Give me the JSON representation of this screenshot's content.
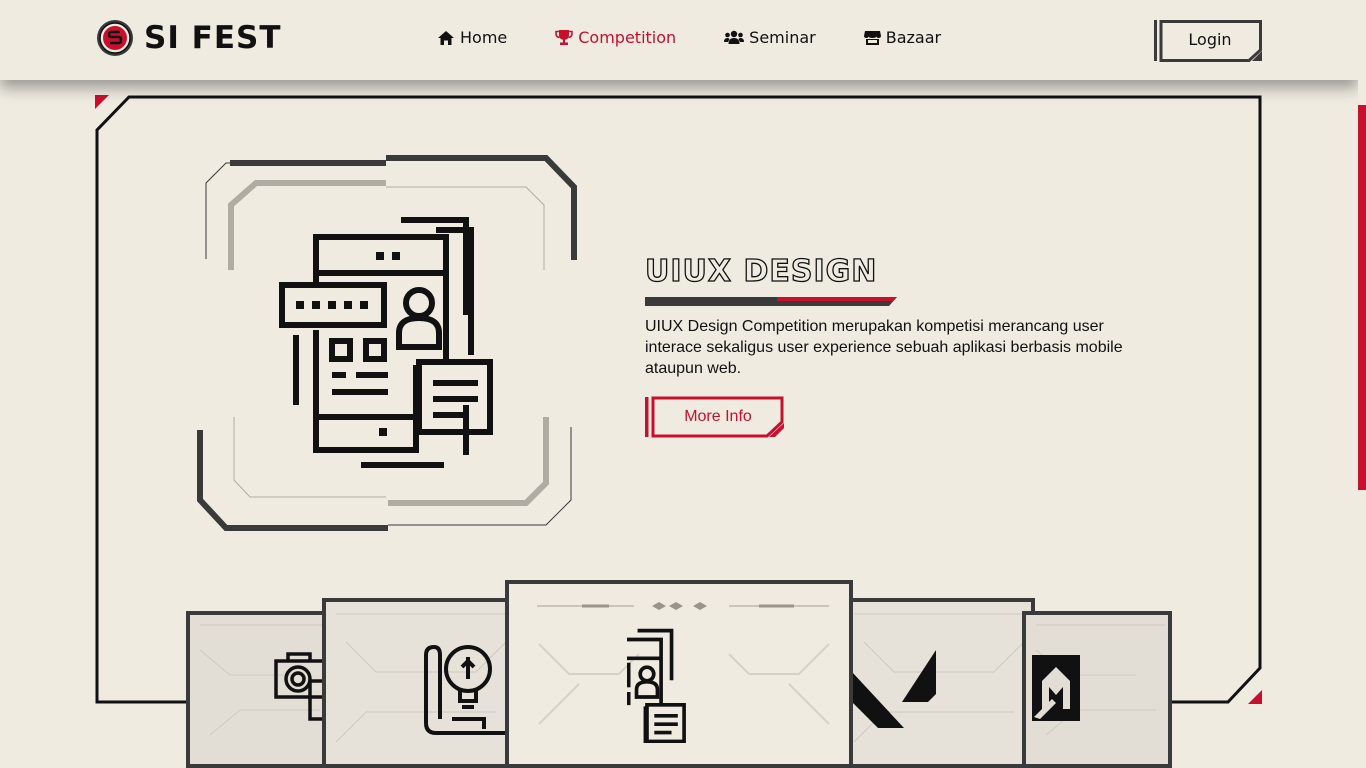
{
  "brand": {
    "name": "SI FEST",
    "logo_letter": "S"
  },
  "nav": {
    "items": [
      {
        "label": "Home",
        "icon": "home-icon",
        "active": false
      },
      {
        "label": "Competition",
        "icon": "trophy-icon",
        "active": true
      },
      {
        "label": "Seminar",
        "icon": "users-icon",
        "active": false
      },
      {
        "label": "Bazaar",
        "icon": "store-icon",
        "active": false
      }
    ],
    "login_label": "Login"
  },
  "hero": {
    "title": "UIUX DESIGN",
    "description": "UIUX Design Competition merupakan kompetisi merancang user interace sekaligus user experience sebuah aplikasi berbasis mobile ataupun web.",
    "button_label": "More Info",
    "illustration_icon": "mobile-ui-design-icon"
  },
  "carousel": {
    "cards": [
      {
        "icon": "camera-photos-icon",
        "selected": false
      },
      {
        "icon": "lightbulb-blueprint-icon",
        "selected": false
      },
      {
        "icon": "mobile-ui-design-icon",
        "selected": true
      },
      {
        "icon": "valorant-logo-icon",
        "selected": false
      },
      {
        "icon": "mobile-legends-logo-icon",
        "selected": false
      }
    ]
  },
  "colors": {
    "accent": "#c8102e",
    "background": "#efebe1",
    "dark": "#111111",
    "frame_gray": "#3a3a3a"
  }
}
